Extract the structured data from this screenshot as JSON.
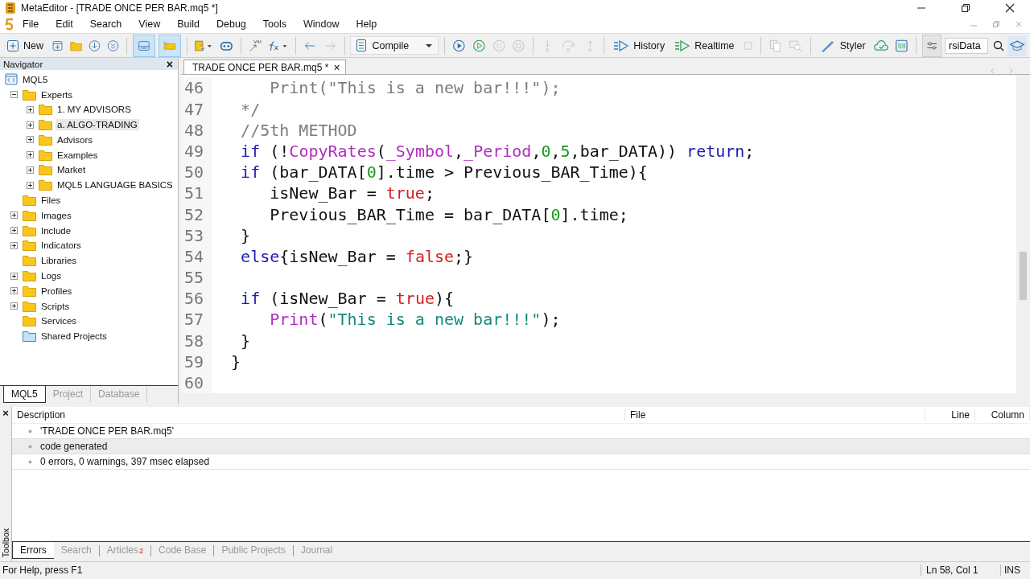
{
  "window": {
    "title": "MetaEditor - [TRADE ONCE PER BAR.mq5 *]"
  },
  "menu": [
    "File",
    "Edit",
    "Search",
    "View",
    "Build",
    "Debug",
    "Tools",
    "Window",
    "Help"
  ],
  "toolbar": {
    "new_label": "New",
    "compile_label": "Compile",
    "history_label": "History",
    "realtime_label": "Realtime",
    "styler_label": "Styler",
    "search_value": "rsiData"
  },
  "navigator": {
    "title": "Navigator",
    "close": "×",
    "tree": [
      {
        "label": "MQL5",
        "kind": "root",
        "selected": false,
        "children": [
          {
            "label": "Experts",
            "kind": "folder",
            "expanded": true,
            "selected": false,
            "children": [
              {
                "label": "1. MY ADVISORS",
                "kind": "folder",
                "expanded": false,
                "selected": false
              },
              {
                "label": "a. ALGO-TRADING",
                "kind": "folder",
                "expanded": false,
                "selected": true
              },
              {
                "label": "Advisors",
                "kind": "folder",
                "expanded": false,
                "selected": false
              },
              {
                "label": "Examples",
                "kind": "folder",
                "expanded": false,
                "selected": false
              },
              {
                "label": "Market",
                "kind": "folder",
                "expanded": false,
                "selected": false
              },
              {
                "label": "MQL5 LANGUAGE BASICS",
                "kind": "folder",
                "expanded": false,
                "selected": false
              }
            ]
          },
          {
            "label": "Files",
            "kind": "folder",
            "selected": false
          },
          {
            "label": "Images",
            "kind": "folder",
            "expanded": false,
            "selected": false
          },
          {
            "label": "Include",
            "kind": "folder",
            "expanded": false,
            "selected": false
          },
          {
            "label": "Indicators",
            "kind": "folder",
            "expanded": false,
            "selected": false
          },
          {
            "label": "Libraries",
            "kind": "folder",
            "selected": false
          },
          {
            "label": "Logs",
            "kind": "folder",
            "expanded": false,
            "selected": false
          },
          {
            "label": "Profiles",
            "kind": "folder",
            "expanded": false,
            "selected": false
          },
          {
            "label": "Scripts",
            "kind": "folder",
            "expanded": false,
            "selected": false
          },
          {
            "label": "Services",
            "kind": "folder",
            "selected": false
          },
          {
            "label": "Shared Projects",
            "kind": "shared",
            "selected": false
          }
        ]
      }
    ],
    "tabs": [
      {
        "label": "MQL5",
        "selected": true
      },
      {
        "label": "Project",
        "selected": false
      },
      {
        "label": "Database",
        "selected": false
      }
    ]
  },
  "editor": {
    "tab": {
      "label": "TRADE ONCE PER BAR.mq5 *",
      "close": "×"
    },
    "lines": [
      {
        "number": "46",
        "tokens": [
          {
            "text": "      Print(\"This is a new bar!!!\");",
            "kind": "comment"
          }
        ]
      },
      {
        "number": "47",
        "tokens": [
          {
            "text": "   */",
            "kind": "comment"
          }
        ]
      },
      {
        "number": "48",
        "tokens": [
          {
            "text": "   //5th METHOD",
            "kind": "comment"
          }
        ]
      },
      {
        "number": "49",
        "tokens": [
          {
            "text": "   if",
            "kind": "keyword"
          },
          {
            "text": " (!",
            "kind": "plain"
          },
          {
            "text": "CopyRates",
            "kind": "function"
          },
          {
            "text": "(",
            "kind": "plain"
          },
          {
            "text": "_Symbol",
            "kind": "function"
          },
          {
            "text": ",",
            "kind": "plain"
          },
          {
            "text": "_Period",
            "kind": "function"
          },
          {
            "text": ",",
            "kind": "plain"
          },
          {
            "text": "0",
            "kind": "number"
          },
          {
            "text": ",",
            "kind": "plain"
          },
          {
            "text": "5",
            "kind": "number"
          },
          {
            "text": ",bar_DATA)) ",
            "kind": "plain"
          },
          {
            "text": "return",
            "kind": "keyword"
          },
          {
            "text": ";",
            "kind": "plain"
          }
        ]
      },
      {
        "number": "50",
        "tokens": [
          {
            "text": "   if",
            "kind": "keyword"
          },
          {
            "text": " (bar_DATA[",
            "kind": "plain"
          },
          {
            "text": "0",
            "kind": "number"
          },
          {
            "text": "].time > Previous_BAR_Time){",
            "kind": "plain"
          }
        ]
      },
      {
        "number": "51",
        "tokens": [
          {
            "text": "      isNew_Bar = ",
            "kind": "plain"
          },
          {
            "text": "true",
            "kind": "boolean"
          },
          {
            "text": ";",
            "kind": "plain"
          }
        ]
      },
      {
        "number": "52",
        "tokens": [
          {
            "text": "      Previous_BAR_Time = bar_DATA[",
            "kind": "plain"
          },
          {
            "text": "0",
            "kind": "number"
          },
          {
            "text": "].time;",
            "kind": "plain"
          }
        ]
      },
      {
        "number": "53",
        "tokens": [
          {
            "text": "   }",
            "kind": "plain"
          }
        ]
      },
      {
        "number": "54",
        "tokens": [
          {
            "text": "   else",
            "kind": "keyword"
          },
          {
            "text": "{isNew_Bar = ",
            "kind": "plain"
          },
          {
            "text": "false",
            "kind": "boolean"
          },
          {
            "text": ";}",
            "kind": "plain"
          }
        ]
      },
      {
        "number": "55"
      },
      {
        "number": "56",
        "tokens": [
          {
            "text": "   if",
            "kind": "keyword"
          },
          {
            "text": " (isNew_Bar = ",
            "kind": "plain"
          },
          {
            "text": "true",
            "kind": "boolean"
          },
          {
            "text": "){",
            "kind": "plain"
          }
        ]
      },
      {
        "number": "57",
        "tokens": [
          {
            "text": "      Print",
            "kind": "function"
          },
          {
            "text": "(",
            "kind": "plain"
          },
          {
            "text": "\"This is a new bar!!!\"",
            "kind": "string"
          },
          {
            "text": ");",
            "kind": "plain"
          }
        ]
      },
      {
        "number": "58",
        "tokens": [
          {
            "text": "   }",
            "kind": "plain"
          }
        ]
      },
      {
        "number": "59",
        "tokens": [
          {
            "text": "  }",
            "kind": "plain"
          }
        ]
      },
      {
        "number": "60"
      }
    ]
  },
  "toolbox": {
    "label": "Toolbox",
    "close": "×",
    "columns": [
      "Description",
      "File",
      "Line",
      "Column"
    ],
    "rows": [
      {
        "description": "'TRADE ONCE PER BAR.mq5'",
        "selected": false
      },
      {
        "description": "code generated",
        "selected": true
      },
      {
        "description": "0 errors, 0 warnings, 397 msec elapsed",
        "selected": false
      }
    ],
    "tabs": [
      {
        "label": "Errors",
        "selected": true
      },
      {
        "label": "Search",
        "selected": false
      },
      {
        "label": "Articles",
        "badge": "2",
        "selected": false
      },
      {
        "label": "Code Base",
        "selected": false
      },
      {
        "label": "Public Projects",
        "selected": false
      },
      {
        "label": "Journal",
        "selected": false
      }
    ]
  },
  "status_bar": {
    "help": "For Help, press F1",
    "position": "Ln 58, Col 1",
    "mode": "INS"
  }
}
